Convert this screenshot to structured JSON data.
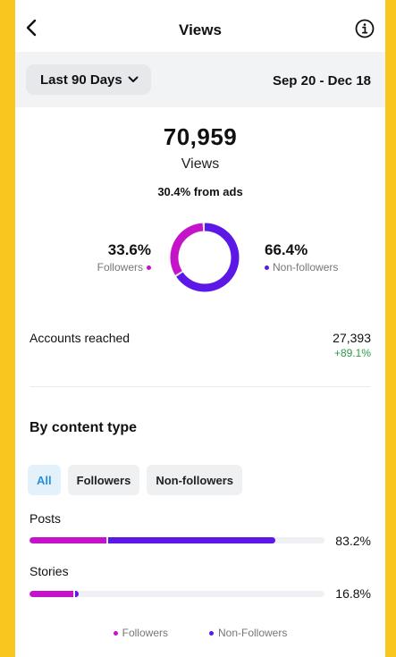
{
  "header": {
    "title": "Views"
  },
  "filter": {
    "range_label": "Last 90 Days",
    "date_range": "Sep 20 - Dec 18"
  },
  "summary": {
    "total": "70,959",
    "label": "Views",
    "ads_text": "30.4% from ads",
    "followers_pct_text": "33.6%",
    "followers_label": "Followers",
    "nonfollowers_pct_text": "66.4%",
    "nonfollowers_label": "Non-followers",
    "followers_share": 33.6,
    "nonfollowers_share": 66.4
  },
  "accounts": {
    "label": "Accounts reached",
    "value": "27,393",
    "delta": "+89.1%"
  },
  "content_type": {
    "title": "By content type",
    "tabs": [
      "All",
      "Followers",
      "Non-followers"
    ],
    "active_tab": "All",
    "rows": [
      {
        "label": "Posts",
        "pct_text": "83.2%",
        "total": 83.2,
        "followers": 26.0,
        "nonfollowers": 57.2
      },
      {
        "label": "Stories",
        "pct_text": "16.8%",
        "total": 16.8,
        "followers": 14.8,
        "nonfollowers": 2.0
      }
    ],
    "legend": [
      "Followers",
      "Non-Followers"
    ]
  },
  "colors": {
    "followers": "#c513c9",
    "nonfollowers": "#5b18e6",
    "positive": "#2e9a4c",
    "active_chip_text": "#2a8fd8"
  },
  "icons": {
    "back": "chevron-left-icon",
    "info": "info-icon",
    "dropdown": "chevron-down-icon"
  }
}
